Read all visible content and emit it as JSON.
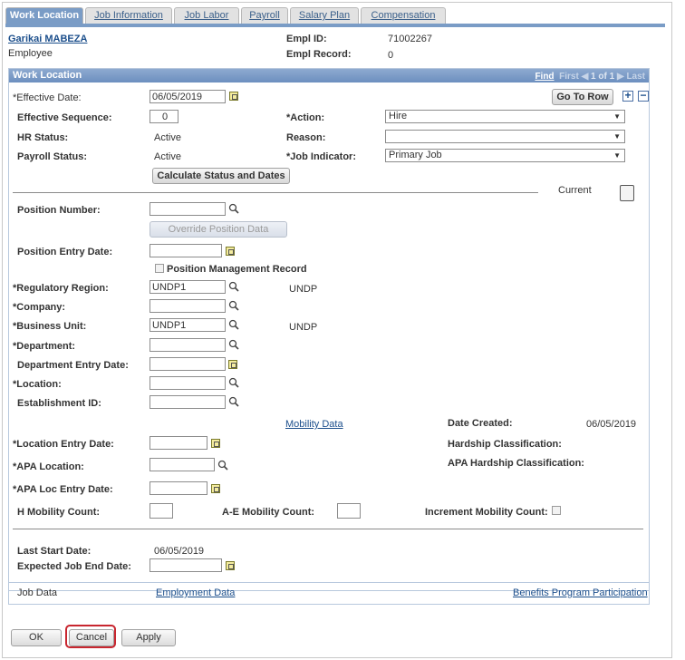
{
  "tabs": [
    "Work Location",
    "Job Information",
    "Job Labor",
    "Payroll",
    "Salary Plan",
    "Compensation"
  ],
  "employee": {
    "name": "Garikai MABEZA",
    "role": "Employee",
    "empl_id_label": "Empl ID:",
    "empl_id": "71002267",
    "empl_record_label": "Empl Record:",
    "empl_record": "0"
  },
  "section": {
    "title": "Work Location",
    "nav": {
      "find": "Find",
      "first": "First",
      "count": "1 of 1",
      "last": "Last"
    },
    "go_to_row": "Go To Row"
  },
  "fields": {
    "effective_date_label": "*Effective Date:",
    "effective_date": "06/05/2019",
    "effective_sequence_label": "Effective Sequence:",
    "effective_sequence": "0",
    "action_label": "*Action:",
    "action": "Hire",
    "hr_status_label": "HR Status:",
    "hr_status": "Active",
    "reason_label": "Reason:",
    "reason": "",
    "payroll_status_label": "Payroll Status:",
    "payroll_status": "Active",
    "job_indicator_label": "*Job Indicator:",
    "job_indicator": "Primary Job",
    "calc_button": "Calculate Status and Dates",
    "current": "Current",
    "position_number_label": "Position Number:",
    "override_button": "Override Position Data",
    "position_entry_date_label": "Position Entry Date:",
    "position_mgmt_record": "Position Management Record",
    "regulatory_region_label": "*Regulatory Region:",
    "regulatory_region": "UNDP1",
    "regulatory_region_desc": "UNDP",
    "company_label": "*Company:",
    "business_unit_label": "*Business Unit:",
    "business_unit": "UNDP1",
    "business_unit_desc": "UNDP",
    "department_label": "*Department:",
    "department_entry_date_label": "Department Entry Date:",
    "location_label": "*Location:",
    "establishment_id_label": "Establishment ID:",
    "mobility_data": "Mobility Data",
    "date_created_label": "Date Created:",
    "date_created": "06/05/2019",
    "location_entry_date_label": "*Location Entry Date:",
    "hardship_label": "Hardship Classification:",
    "apa_location_label": "*APA Location:",
    "apa_hardship_label": "APA Hardship Classification:",
    "apa_loc_entry_date_label": "*APA Loc Entry Date:",
    "h_mobility_label": "H Mobility Count:",
    "ae_mobility_label": "A-E Mobility Count:",
    "increment_mobility_label": "Increment Mobility Count:",
    "last_start_date_label": "Last Start Date:",
    "last_start_date": "06/05/2019",
    "expected_end_label": "Expected Job End Date:"
  },
  "footer_links": {
    "job_data": "Job Data",
    "employment_data": "Employment Data",
    "benefits": "Benefits Program Participation"
  },
  "buttons": {
    "ok": "OK",
    "cancel": "Cancel",
    "apply": "Apply"
  }
}
